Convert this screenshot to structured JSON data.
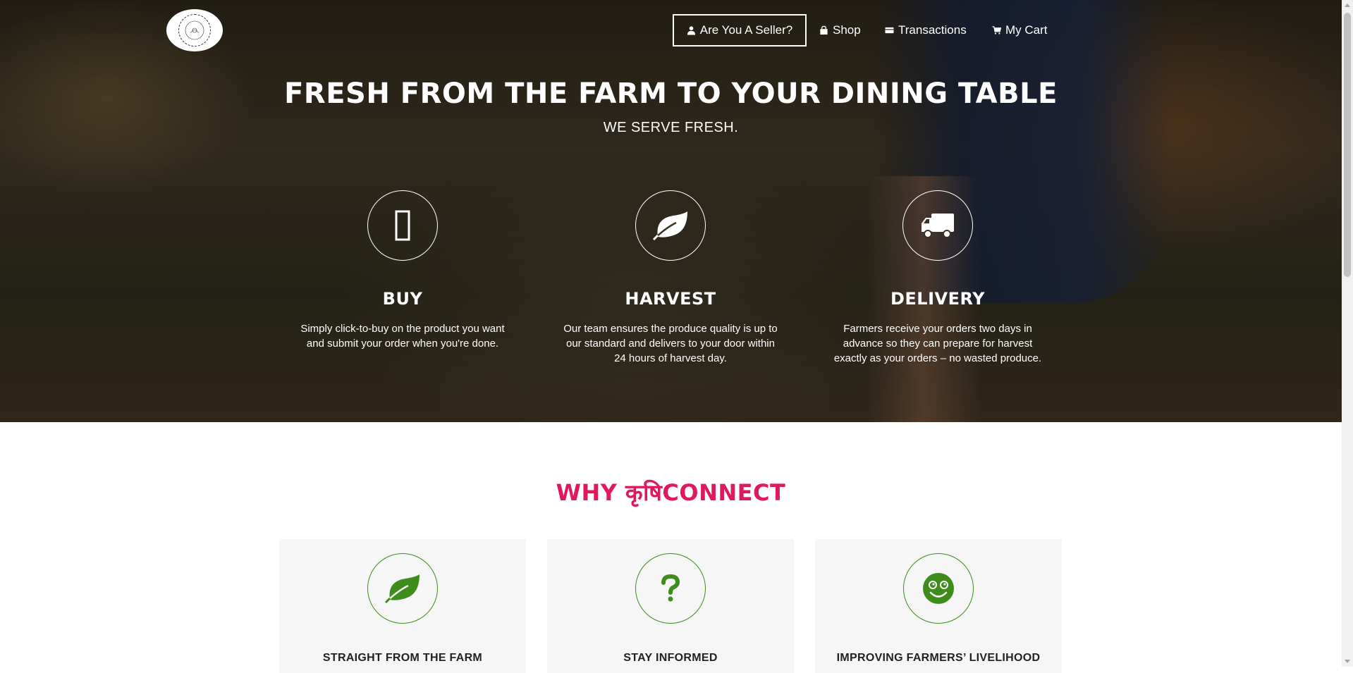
{
  "nav": {
    "seller_button": "Are You A Seller?",
    "shop": "Shop",
    "transactions": "Transactions",
    "cart": "My Cart"
  },
  "hero": {
    "title": "FRESH FROM THE FARM TO YOUR DINING TABLE",
    "subtitle": "WE SERVE FRESH."
  },
  "features": [
    {
      "icon": "placeholder-box-icon",
      "title": "BUY",
      "text": "Simply click-to-buy on the product you want and submit your order when you're done."
    },
    {
      "icon": "leaf-icon",
      "title": "HARVEST",
      "text": "Our team ensures the produce quality is up to our standard and delivers to your door within 24 hours of harvest day."
    },
    {
      "icon": "truck-icon",
      "title": "DELIVERY",
      "text": "Farmers receive your orders two days in advance so they can prepare for harvest exactly as your orders – no wasted produce."
    }
  ],
  "why": {
    "title": "WHY कृषिCONNECT",
    "cards": [
      {
        "icon": "leaf-icon",
        "title": "STRAIGHT FROM THE FARM"
      },
      {
        "icon": "question-icon",
        "title": "STAY INFORMED"
      },
      {
        "icon": "smile-icon",
        "title": "IMPROVING FARMERS’ LIVELIHOOD"
      }
    ]
  },
  "colors": {
    "accent": "#e0195c",
    "green": "#3d8c1c"
  }
}
